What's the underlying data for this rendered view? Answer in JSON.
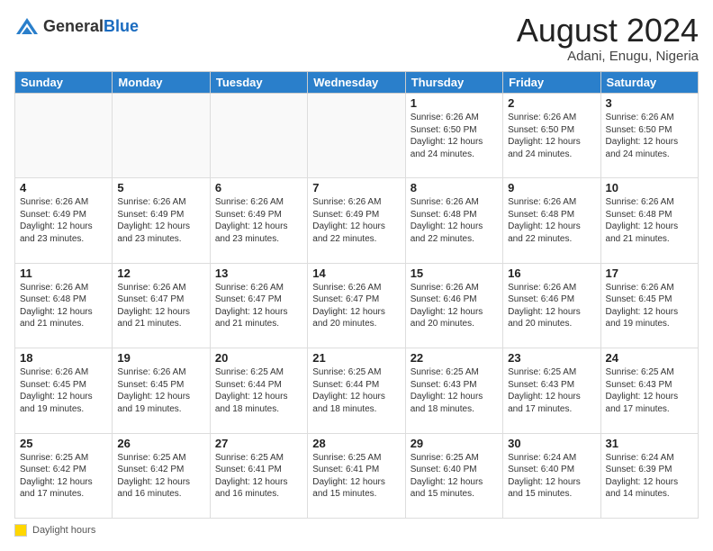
{
  "logo": {
    "general": "General",
    "blue": "Blue"
  },
  "header": {
    "month_year": "August 2024",
    "location": "Adani, Enugu, Nigeria"
  },
  "days_of_week": [
    "Sunday",
    "Monday",
    "Tuesday",
    "Wednesday",
    "Thursday",
    "Friday",
    "Saturday"
  ],
  "footer": {
    "swatch_label": "Daylight hours"
  },
  "weeks": [
    [
      {
        "day": "",
        "info": ""
      },
      {
        "day": "",
        "info": ""
      },
      {
        "day": "",
        "info": ""
      },
      {
        "day": "",
        "info": ""
      },
      {
        "day": "1",
        "info": "Sunrise: 6:26 AM\nSunset: 6:50 PM\nDaylight: 12 hours\nand 24 minutes."
      },
      {
        "day": "2",
        "info": "Sunrise: 6:26 AM\nSunset: 6:50 PM\nDaylight: 12 hours\nand 24 minutes."
      },
      {
        "day": "3",
        "info": "Sunrise: 6:26 AM\nSunset: 6:50 PM\nDaylight: 12 hours\nand 24 minutes."
      }
    ],
    [
      {
        "day": "4",
        "info": "Sunrise: 6:26 AM\nSunset: 6:49 PM\nDaylight: 12 hours\nand 23 minutes."
      },
      {
        "day": "5",
        "info": "Sunrise: 6:26 AM\nSunset: 6:49 PM\nDaylight: 12 hours\nand 23 minutes."
      },
      {
        "day": "6",
        "info": "Sunrise: 6:26 AM\nSunset: 6:49 PM\nDaylight: 12 hours\nand 23 minutes."
      },
      {
        "day": "7",
        "info": "Sunrise: 6:26 AM\nSunset: 6:49 PM\nDaylight: 12 hours\nand 22 minutes."
      },
      {
        "day": "8",
        "info": "Sunrise: 6:26 AM\nSunset: 6:48 PM\nDaylight: 12 hours\nand 22 minutes."
      },
      {
        "day": "9",
        "info": "Sunrise: 6:26 AM\nSunset: 6:48 PM\nDaylight: 12 hours\nand 22 minutes."
      },
      {
        "day": "10",
        "info": "Sunrise: 6:26 AM\nSunset: 6:48 PM\nDaylight: 12 hours\nand 21 minutes."
      }
    ],
    [
      {
        "day": "11",
        "info": "Sunrise: 6:26 AM\nSunset: 6:48 PM\nDaylight: 12 hours\nand 21 minutes."
      },
      {
        "day": "12",
        "info": "Sunrise: 6:26 AM\nSunset: 6:47 PM\nDaylight: 12 hours\nand 21 minutes."
      },
      {
        "day": "13",
        "info": "Sunrise: 6:26 AM\nSunset: 6:47 PM\nDaylight: 12 hours\nand 21 minutes."
      },
      {
        "day": "14",
        "info": "Sunrise: 6:26 AM\nSunset: 6:47 PM\nDaylight: 12 hours\nand 20 minutes."
      },
      {
        "day": "15",
        "info": "Sunrise: 6:26 AM\nSunset: 6:46 PM\nDaylight: 12 hours\nand 20 minutes."
      },
      {
        "day": "16",
        "info": "Sunrise: 6:26 AM\nSunset: 6:46 PM\nDaylight: 12 hours\nand 20 minutes."
      },
      {
        "day": "17",
        "info": "Sunrise: 6:26 AM\nSunset: 6:45 PM\nDaylight: 12 hours\nand 19 minutes."
      }
    ],
    [
      {
        "day": "18",
        "info": "Sunrise: 6:26 AM\nSunset: 6:45 PM\nDaylight: 12 hours\nand 19 minutes."
      },
      {
        "day": "19",
        "info": "Sunrise: 6:26 AM\nSunset: 6:45 PM\nDaylight: 12 hours\nand 19 minutes."
      },
      {
        "day": "20",
        "info": "Sunrise: 6:25 AM\nSunset: 6:44 PM\nDaylight: 12 hours\nand 18 minutes."
      },
      {
        "day": "21",
        "info": "Sunrise: 6:25 AM\nSunset: 6:44 PM\nDaylight: 12 hours\nand 18 minutes."
      },
      {
        "day": "22",
        "info": "Sunrise: 6:25 AM\nSunset: 6:43 PM\nDaylight: 12 hours\nand 18 minutes."
      },
      {
        "day": "23",
        "info": "Sunrise: 6:25 AM\nSunset: 6:43 PM\nDaylight: 12 hours\nand 17 minutes."
      },
      {
        "day": "24",
        "info": "Sunrise: 6:25 AM\nSunset: 6:43 PM\nDaylight: 12 hours\nand 17 minutes."
      }
    ],
    [
      {
        "day": "25",
        "info": "Sunrise: 6:25 AM\nSunset: 6:42 PM\nDaylight: 12 hours\nand 17 minutes."
      },
      {
        "day": "26",
        "info": "Sunrise: 6:25 AM\nSunset: 6:42 PM\nDaylight: 12 hours\nand 16 minutes."
      },
      {
        "day": "27",
        "info": "Sunrise: 6:25 AM\nSunset: 6:41 PM\nDaylight: 12 hours\nand 16 minutes."
      },
      {
        "day": "28",
        "info": "Sunrise: 6:25 AM\nSunset: 6:41 PM\nDaylight: 12 hours\nand 15 minutes."
      },
      {
        "day": "29",
        "info": "Sunrise: 6:25 AM\nSunset: 6:40 PM\nDaylight: 12 hours\nand 15 minutes."
      },
      {
        "day": "30",
        "info": "Sunrise: 6:24 AM\nSunset: 6:40 PM\nDaylight: 12 hours\nand 15 minutes."
      },
      {
        "day": "31",
        "info": "Sunrise: 6:24 AM\nSunset: 6:39 PM\nDaylight: 12 hours\nand 14 minutes."
      }
    ]
  ]
}
